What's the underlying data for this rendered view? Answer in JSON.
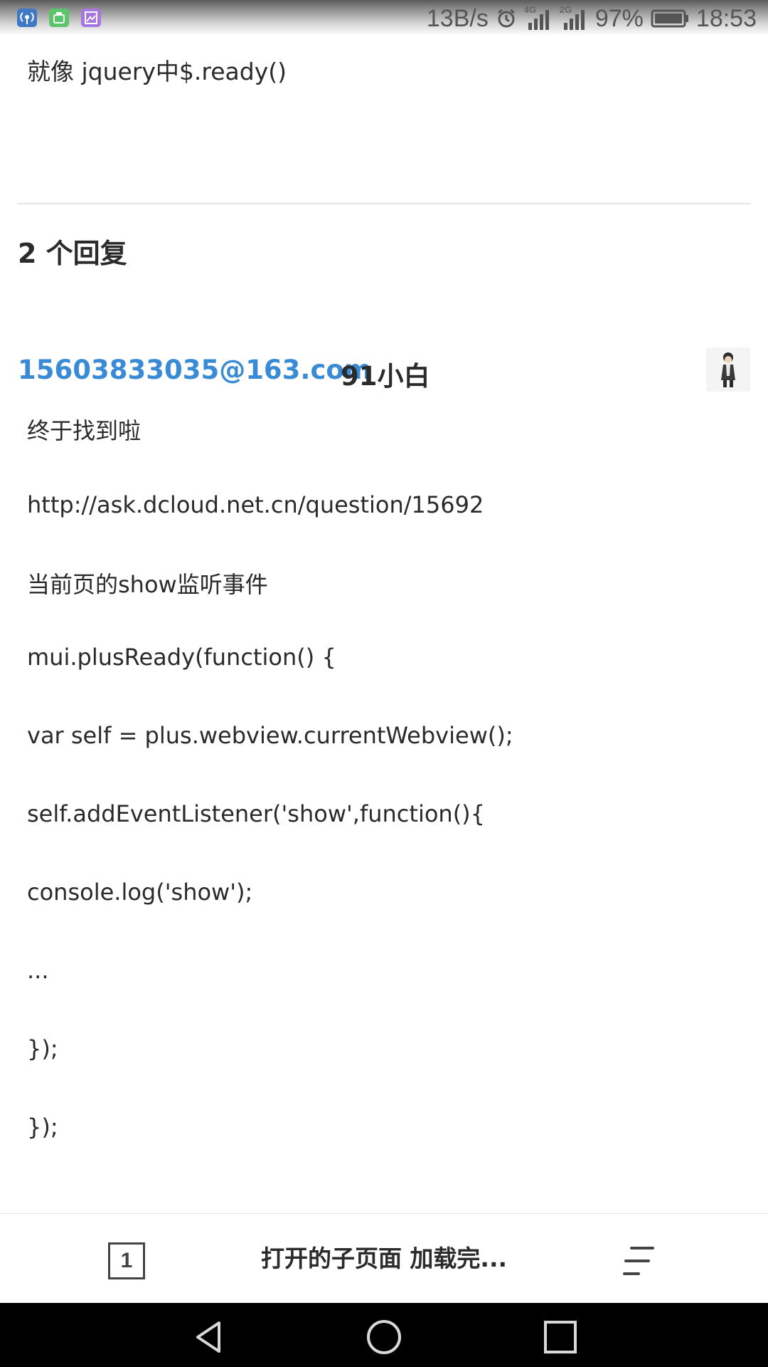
{
  "status_bar": {
    "network_speed": "13B/s",
    "signal_1_tag": "4G",
    "signal_2_tag": "2G",
    "battery": "97%",
    "time": "18:53",
    "icons": [
      "hotspot-app-icon",
      "android-app-icon",
      "gallery-app-icon",
      "alarm-icon",
      "signal-icon",
      "battery-icon"
    ]
  },
  "question": {
    "tail_text": "就像 jquery中$.ready()"
  },
  "replies": {
    "count_label": "2 个回复",
    "items": [
      {
        "author": "15603833035@163.com",
        "nickname": "91小白",
        "lines": [
          "终于找到啦",
          "http://ask.dcloud.net.cn/question/15692",
          "当前页的show监听事件",
          "mui.plusReady(function() {",
          "var self = plus.webview.currentWebview();",
          "self.addEventListener('show',function(){",
          "console.log('show');",
          "...",
          "});",
          "});"
        ]
      }
    ]
  },
  "toolbar": {
    "tab_count": "1",
    "page_title": "打开的子页面 加载完...",
    "menu_icon": "menu-icon"
  },
  "nav_bar": {
    "icons": [
      "back-icon",
      "home-icon",
      "recents-icon"
    ]
  },
  "colors": {
    "link": "#3a8bd6",
    "text": "#2a2a2a",
    "divider": "#e6e6e6",
    "nav_bar": "#000000"
  }
}
